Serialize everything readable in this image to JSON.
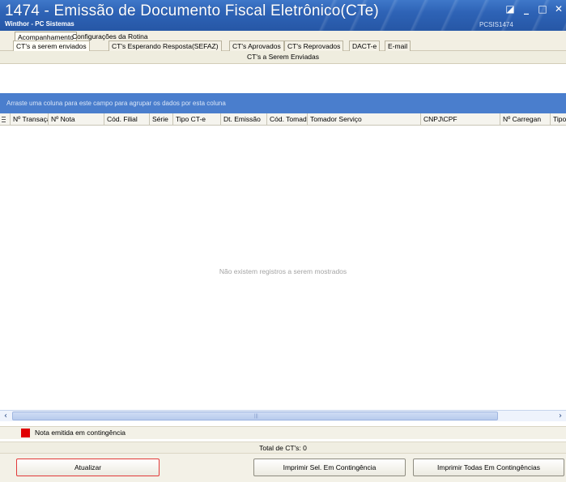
{
  "window": {
    "title": "1474 - Emissão de Documento Fiscal Eletrônico(CTe)",
    "subtitle": "Winthor - PC Sistemas",
    "routine_code": "PCSIS1474",
    "controls": {
      "restore": "◪",
      "minimize": "_",
      "maximize": "□",
      "close": "✕"
    }
  },
  "tabs_outer": [
    {
      "label": "Acompanhamento",
      "active": true
    },
    {
      "label": "Configurações da Rotina",
      "active": false
    }
  ],
  "tabs_inner": [
    {
      "label": "CT's a serem enviados",
      "active": true
    },
    {
      "label": "CT's Esperando Resposta(SEFAZ)",
      "active": false
    },
    {
      "label": "CT's Aprovados",
      "active": false
    },
    {
      "label": "CT's Reprovados",
      "active": false
    },
    {
      "label": "DACT-e",
      "active": false
    },
    {
      "label": "E-mail",
      "active": false
    }
  ],
  "grid": {
    "caption": "CT's a Serem Enviadas",
    "group_by_hint": "Arraste uma coluna para este campo para agrupar os dados por esta coluna",
    "columns": [
      "Nº Transaçã",
      "Nº Nota",
      "Cód. Filial",
      "Série",
      "Tipo CT-e",
      "Dt. Emissão",
      "Cód. Tomad",
      "Tomador Serviço",
      "CNPJ\\CPF",
      "Nº Carregan",
      "Tipo"
    ],
    "empty_message": "Não existem registros a serem mostrados",
    "rows": []
  },
  "legend": {
    "label": "Nota emitida em contingência",
    "color": "#e00000"
  },
  "total": "Total de CT's: 0",
  "buttons": {
    "refresh": "Atualizar",
    "print_selected": "Imprimir Sel. Em Contingência",
    "print_all": "Imprimir Todas  Em Contingências"
  },
  "colors": {
    "titlebar": "#2e63b6",
    "groupby_panel": "#4a7ecd",
    "highlight": "#e23a3a"
  }
}
